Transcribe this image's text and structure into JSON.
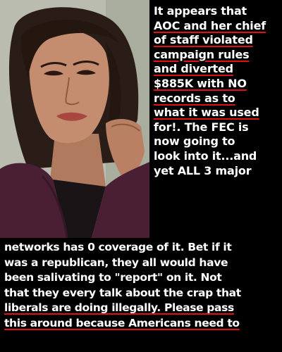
{
  "text_right": [
    {
      "text": "It appears that",
      "underline": false
    },
    {
      "text": "AOC and her chief",
      "underline": true
    },
    {
      "text": "of staff violated",
      "underline": true
    },
    {
      "text": "campaign rules",
      "underline": true
    },
    {
      "text": "and diverted",
      "underline": true
    },
    {
      "text": "$885K with NO",
      "underline": true
    },
    {
      "text": "records as to",
      "underline": true
    },
    {
      "text": "what it was used",
      "underline": true
    },
    {
      "text": "for!. The FEC is",
      "underline": false
    },
    {
      "text": "now going to",
      "underline": false
    },
    {
      "text": "look into it...and",
      "underline": false
    },
    {
      "text": "yet ALL 3 major",
      "underline": false
    }
  ],
  "text_bottom": [
    {
      "text": "networks has 0 coverage of it. Bet if it"
    },
    {
      "text": "was a republican, they all would have"
    },
    {
      "text": "been salivating to \"report\" on it. Not"
    },
    {
      "text": "that they every talk about the crap that"
    },
    {
      "text": "liberals are doing illegally. Please pass",
      "highlight": "Please pass"
    },
    {
      "text": "this around because Americans need to",
      "underline": true
    }
  ],
  "colors": {
    "background": "#000000",
    "text": "#ffffff",
    "underline": "#e0101a"
  }
}
